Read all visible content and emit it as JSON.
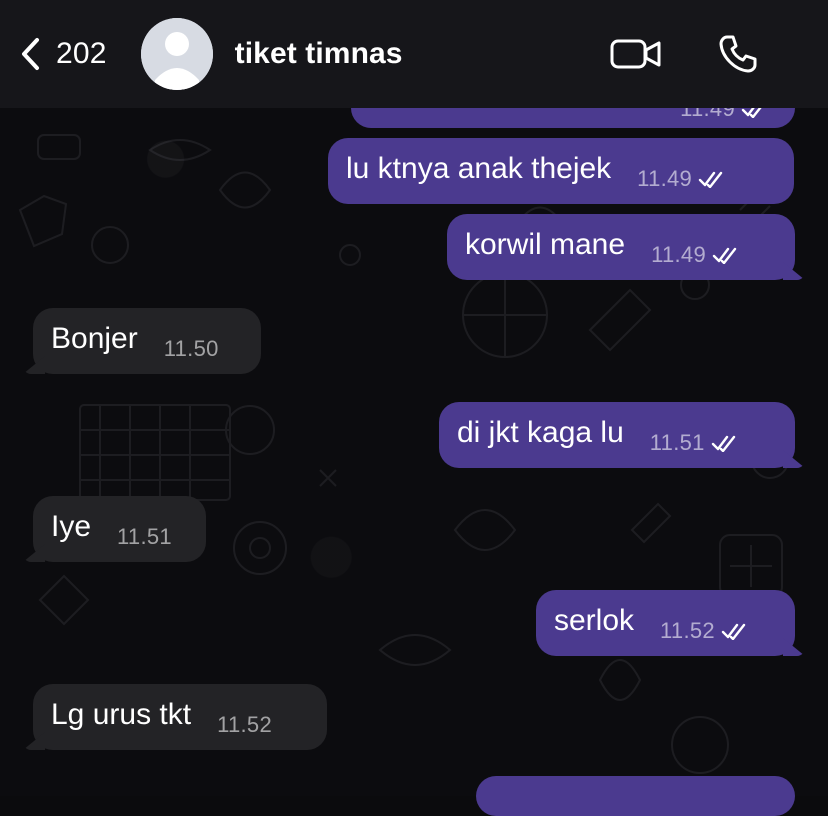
{
  "header": {
    "back_label": "202",
    "contact_name": "tiket timnas",
    "icons": {
      "back": "chevron-left-icon",
      "avatar": "person-icon",
      "video": "video-camera-icon",
      "phone": "phone-icon"
    }
  },
  "messages": [
    {
      "direction": "outgoing",
      "text": "",
      "time": "11.49",
      "status": "read"
    },
    {
      "direction": "outgoing",
      "text": "lu ktnya anak thejek",
      "time": "11.49",
      "status": "read"
    },
    {
      "direction": "outgoing",
      "text": "korwil mane",
      "time": "11.49",
      "status": "read"
    },
    {
      "direction": "incoming",
      "text": "Bonjer",
      "time": "11.50"
    },
    {
      "direction": "outgoing",
      "text": "di jkt kaga lu",
      "time": "11.51",
      "status": "read"
    },
    {
      "direction": "incoming",
      "text": "Iye",
      "time": "11.51"
    },
    {
      "direction": "outgoing",
      "text": "serlok",
      "time": "11.52",
      "status": "read"
    },
    {
      "direction": "incoming",
      "text": "Lg urus tkt",
      "time": "11.52"
    },
    {
      "direction": "outgoing",
      "text": "",
      "time": "",
      "status": ""
    }
  ],
  "colors": {
    "header_bg": "#16161a",
    "outgoing_bubble": "#4b3a8f",
    "incoming_bubble": "#232326",
    "timestamp": "#a8a8ad",
    "text": "#ffffff"
  }
}
